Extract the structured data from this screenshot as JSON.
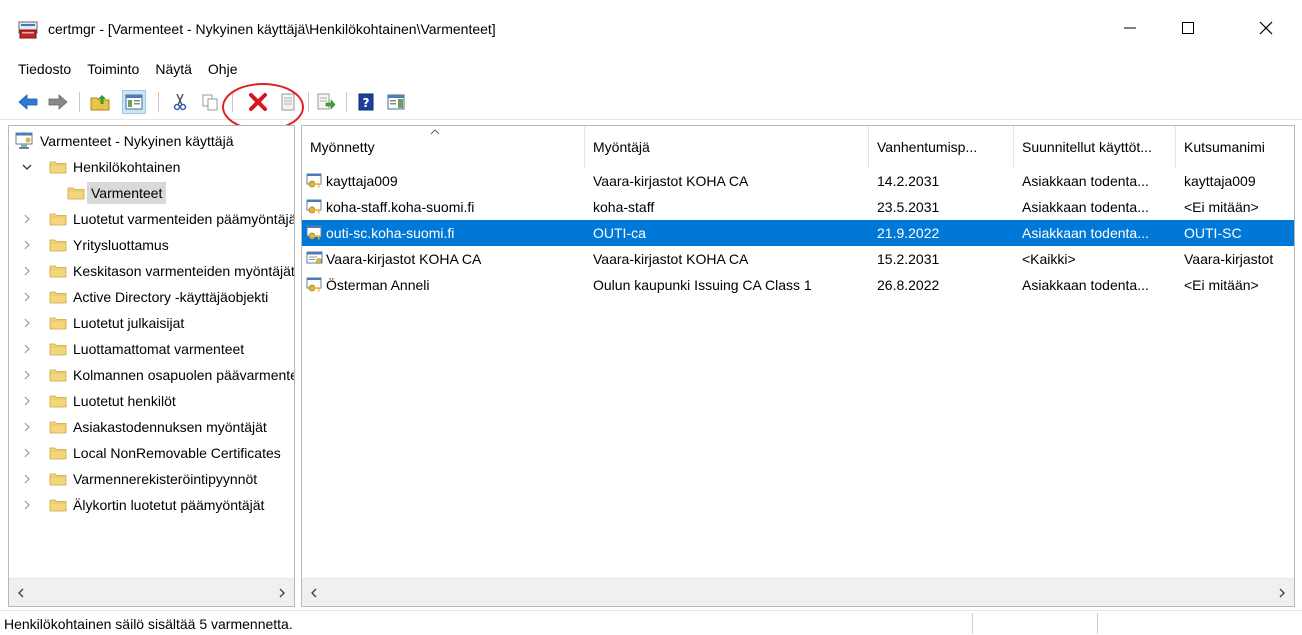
{
  "window": {
    "title": "certmgr - [Varmenteet - Nykyinen käyttäjä\\Henkilökohtainen\\Varmenteet]",
    "icon": "certmgr-app-icon",
    "controls": {
      "minimize": "minimize-icon",
      "maximize": "maximize-icon",
      "close": "close-icon"
    }
  },
  "menu": [
    "Tiedosto",
    "Toiminto",
    "Näytä",
    "Ohje"
  ],
  "toolbar": {
    "buttons": [
      "back-icon",
      "forward-icon",
      "up-folder-icon",
      "show-hide-console-tree-icon",
      "cut-icon",
      "copy-icon",
      "delete-icon",
      "properties-icon",
      "export-list-icon",
      "help-icon",
      "show-hide-action-pane-icon"
    ],
    "highlighted": "delete-icon",
    "highlight_color": "#e02020"
  },
  "tree": {
    "root": "Varmenteet - Nykyinen käyttäjä",
    "items": [
      {
        "label": "Henkilökohtainen",
        "level": 1,
        "expanded": true
      },
      {
        "label": "Varmenteet",
        "level": 2,
        "selected": true
      },
      {
        "label": "Luotetut varmenteiden päämyöntäjät",
        "level": 1
      },
      {
        "label": "Yritysluottamus",
        "level": 1
      },
      {
        "label": "Keskitason varmenteiden myöntäjät",
        "level": 1
      },
      {
        "label": "Active Directory -käyttäjäobjekti",
        "level": 1
      },
      {
        "label": "Luotetut julkaisijat",
        "level": 1
      },
      {
        "label": "Luottamattomat varmenteet",
        "level": 1
      },
      {
        "label": "Kolmannen osapuolen päävarmenteiden myöntäjät",
        "level": 1
      },
      {
        "label": "Luotetut henkilöt",
        "level": 1
      },
      {
        "label": "Asiakastodennuksen myöntäjät",
        "level": 1
      },
      {
        "label": "Local NonRemovable Certificates",
        "level": 1
      },
      {
        "label": "Varmennerekisteröintipyynnöt",
        "level": 1
      },
      {
        "label": "Älykortin luotetut päämyöntäjät",
        "level": 1
      }
    ]
  },
  "list": {
    "columns": [
      "Myönnetty",
      "Myöntäjä",
      "Vanhentumisp...",
      "Suunnitellut käyttöt...",
      "Kutsumanimi"
    ],
    "sorted_column": "Myönnetty",
    "rows": [
      {
        "issued_to": "kayttaja009",
        "issuer": "Vaara-kirjastot KOHA CA",
        "expires": "14.2.2031",
        "purposes": "Asiakkaan todenta...",
        "friendly": "kayttaja009",
        "icon": "certificate-key-icon"
      },
      {
        "issued_to": "koha-staff.koha-suomi.fi",
        "issuer": "koha-staff",
        "expires": "23.5.2031",
        "purposes": "Asiakkaan todenta...",
        "friendly": "<Ei mitään>",
        "icon": "certificate-key-icon"
      },
      {
        "issued_to": "outi-sc.koha-suomi.fi",
        "issuer": "OUTI-ca",
        "expires": "21.9.2022",
        "purposes": "Asiakkaan todenta...",
        "friendly": "OUTI-SC",
        "icon": "certificate-key-icon",
        "selected": true
      },
      {
        "issued_to": "Vaara-kirjastot KOHA CA",
        "issuer": "Vaara-kirjastot KOHA CA",
        "expires": "15.2.2031",
        "purposes": "<Kaikki>",
        "friendly": "Vaara-kirjastot",
        "icon": "certificate-icon"
      },
      {
        "issued_to": "Österman Anneli",
        "issuer": "Oulun kaupunki Issuing CA Class 1",
        "expires": "26.8.2022",
        "purposes": "Asiakkaan todenta...",
        "friendly": "<Ei mitään>",
        "icon": "certificate-key-icon"
      }
    ],
    "selection_color": "#0078d7"
  },
  "status": "Henkilökohtainen säilö sisältää 5 varmennetta."
}
